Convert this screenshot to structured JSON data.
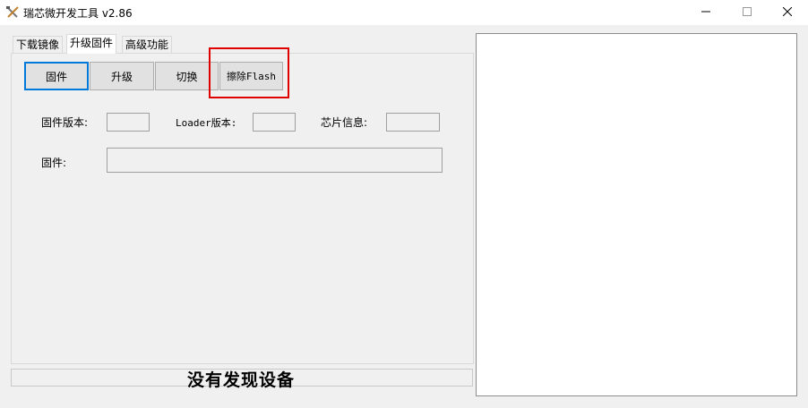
{
  "window": {
    "title": "瑞芯微开发工具 v2.86",
    "app_icon": "crossed-tools-icon",
    "controls": {
      "minimize": "minimize-icon",
      "maximize": "maximize-icon",
      "close": "close-icon"
    }
  },
  "tabs": [
    {
      "label": "下载镜像",
      "active": false
    },
    {
      "label": "升级固件",
      "active": true
    },
    {
      "label": "高级功能",
      "active": false
    }
  ],
  "toolbar": {
    "firmware_label": "固件",
    "upgrade_label": "升级",
    "switch_label": "切换",
    "erase_flash_label": "擦除Flash"
  },
  "info": {
    "firmware_version_label": "固件版本:",
    "firmware_version_value": "",
    "loader_version_label": "Loader版本:",
    "loader_version_value": "",
    "chip_info_label": "芯片信息:",
    "chip_info_value": "",
    "firmware_path_label": "固件:",
    "firmware_path_value": ""
  },
  "status": {
    "text": "没有发现设备"
  },
  "colors": {
    "accent": "#0078d7",
    "highlight": "#e00000",
    "background": "#f0f0f0"
  }
}
